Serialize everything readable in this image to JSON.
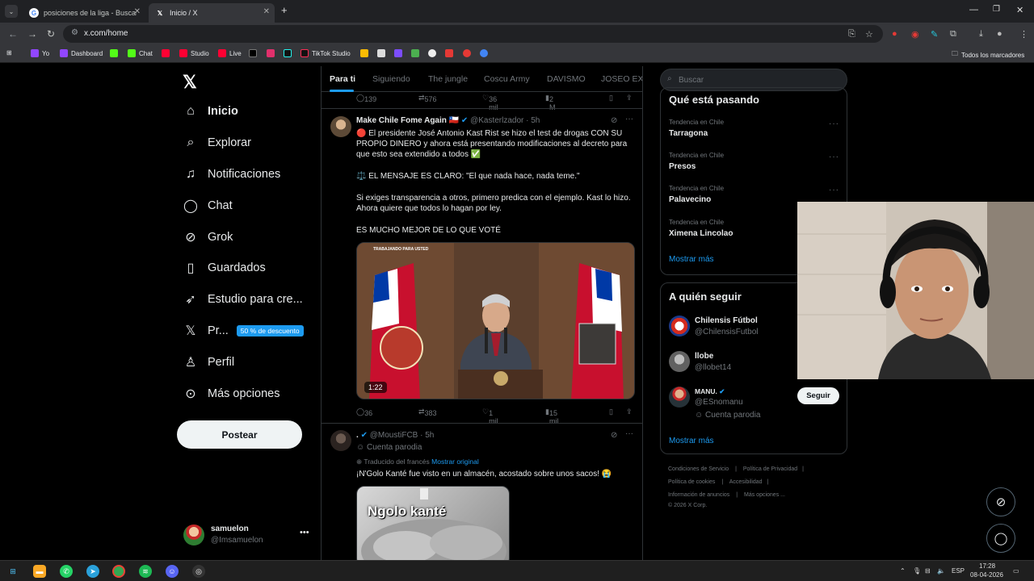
{
  "browser": {
    "tabs": [
      {
        "title": "posiciones de la liga - Buscar co"
      },
      {
        "title": "Inicio / X"
      }
    ],
    "url": "x.com/home",
    "bookmarks": [
      "Yo",
      "Dashboard",
      "Chat",
      "Studio",
      "Live",
      "TikTok Studio"
    ],
    "all_bookmarks": "Todos los marcadores"
  },
  "nav": {
    "home": "Inicio",
    "explore": "Explorar",
    "notifications": "Notificaciones",
    "chat": "Chat",
    "grok": "Grok",
    "bookmarks": "Guardados",
    "creator_studio": "Estudio para cre...",
    "premium": "Pr...",
    "premium_badge": "50 % de descuento",
    "profile": "Perfil",
    "more": "Más opciones",
    "post_button": "Postear"
  },
  "account": {
    "name": "samuelon",
    "handle": "@Imsamuelon"
  },
  "feed_tabs": [
    "Para ti",
    "Siguiendo",
    "The jungle",
    "Coscu Army",
    "DAVISMO",
    "JOSEO EXC"
  ],
  "prev_post_actions": {
    "replies": "139",
    "reposts": "576",
    "likes": "36 mil",
    "views": "2 M"
  },
  "post1": {
    "author": "Make Chile Fome Again",
    "flag": "🇨🇱",
    "handle": "@Kasterlzador",
    "time": "· 5h",
    "text1": "🔴 El presidente José Antonio Kast Rist se hizo el test de drogas CON SU PROPIO DINERO y ahora está presentando modificaciones al decreto para que esto sea extendido a todos ✅",
    "text2": "⚖️ EL MENSAJE ES CLARO: \"El que nada hace, nada teme.\"",
    "text3": "Si exiges transparencia a otros, primero predica con el ejemplo. Kast lo hizo. Ahora quiere que todos lo hagan por ley.",
    "text4": "ES MUCHO MEJOR DE LO QUE VOTÉ",
    "video_caption": "TRABAJANDO PARA USTED",
    "duration": "1:22",
    "replies": "36",
    "reposts": "383",
    "likes": "1 mil",
    "views": "15 mil"
  },
  "post2": {
    "author": ".",
    "handle": "@MoustiFCB",
    "time": "· 5h",
    "parody": "Cuenta parodia",
    "translated": "Traducido del francés",
    "show_original": "Mostrar original",
    "text": "¡N'Golo Kanté fue visto en un almacén, acostado sobre unos sacos! 😭",
    "image_caption": "Ngolo kanté"
  },
  "search_placeholder": "Buscar",
  "trends": {
    "title": "Qué está pasando",
    "items": [
      {
        "label": "Tendencia en Chile",
        "name": "Tarragona"
      },
      {
        "label": "Tendencia en Chile",
        "name": "Presos"
      },
      {
        "label": "Tendencia en Chile",
        "name": "Palavecino"
      },
      {
        "label": "Tendencia en Chile",
        "name": "Ximena Lincolao"
      }
    ],
    "show_more": "Mostrar más"
  },
  "who_to_follow": {
    "title": "A quién seguir",
    "items": [
      {
        "name": "Chilensis Fútbol",
        "handle": "@ChilensisFutbol"
      },
      {
        "name": "llobe",
        "handle": "@llobet14"
      },
      {
        "name": "MANU.",
        "handle": "@ESnomanu",
        "note": "Cuenta parodia"
      }
    ],
    "follow_label": "Seguir",
    "show_more": "Mostrar más"
  },
  "footer": {
    "terms": "Condiciones de Servicio",
    "privacy": "Política de Privacidad",
    "cookies": "Política de cookies",
    "accessibility": "Accesibilidad",
    "ads": "Información de anuncios",
    "more": "Más opciones ...",
    "copyright": "© 2026 X Corp."
  },
  "taskbar": {
    "lang": "ESP",
    "time": "17:28",
    "date": "08-04-2026"
  },
  "colors": {
    "accent": "#1d9bf0",
    "background": "#000000",
    "text": "#e7e9ea",
    "muted": "#71767b"
  }
}
